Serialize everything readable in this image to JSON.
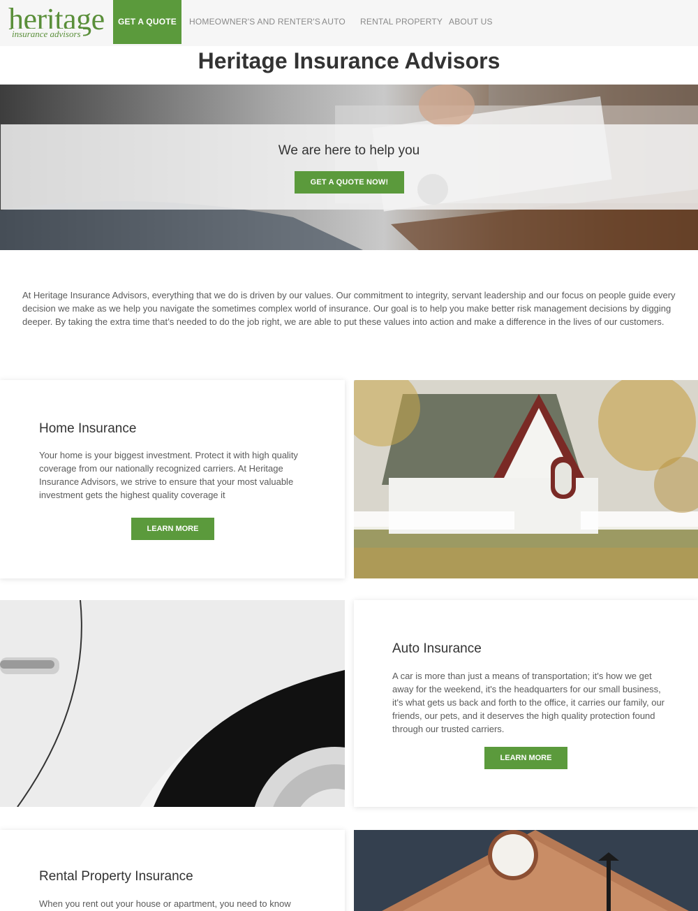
{
  "nav": {
    "logo_main": "heritage",
    "logo_sub": "insurance advisors",
    "items": [
      {
        "label": "GET A QUOTE"
      },
      {
        "label": "HOMEOWNER'S AND RENTER'S"
      },
      {
        "label": "AUTO"
      },
      {
        "label": "RENTAL PROPERTY"
      },
      {
        "label": "ABOUT US"
      }
    ]
  },
  "page_title": "Heritage Insurance Advisors",
  "hero": {
    "heading": "We are here to help you",
    "button": "GET A QUOTE NOW!"
  },
  "intro": "At Heritage Insurance Advisors, everything that we do is driven by our values. Our commitment to integrity, servant leadership and our focus on people guide every decision we make as we help you navigate the sometimes complex world of insurance. Our goal is to help you make better risk management decisions by digging deeper. By taking the extra time that’s needed to do the job right, we are able to put these values into action and make a difference in the lives of our customers.",
  "sections": [
    {
      "title": "Home Insurance",
      "text": "Your home is your biggest investment. Protect it with high quality coverage from our nationally recognized carriers. At Heritage Insurance Advisors, we strive to ensure that your most valuable investment gets the highest quality coverage it",
      "button": "LEARN MORE"
    },
    {
      "title": "Auto Insurance",
      "text": "A car is more than just a means of transportation; it's how we get away for the weekend, it's the headquarters for our small business, it's what gets us back and forth to the office, it carries our family, our friends, our pets, and it deserves the high quality protection found through our trusted carriers.",
      "button": "LEARN MORE"
    },
    {
      "title": "Rental Property Insurance",
      "text": "When you rent out your house or apartment, you need to know"
    }
  ],
  "colors": {
    "brand_green": "#5b9a3c",
    "nav_background": "#f6f6f6"
  }
}
